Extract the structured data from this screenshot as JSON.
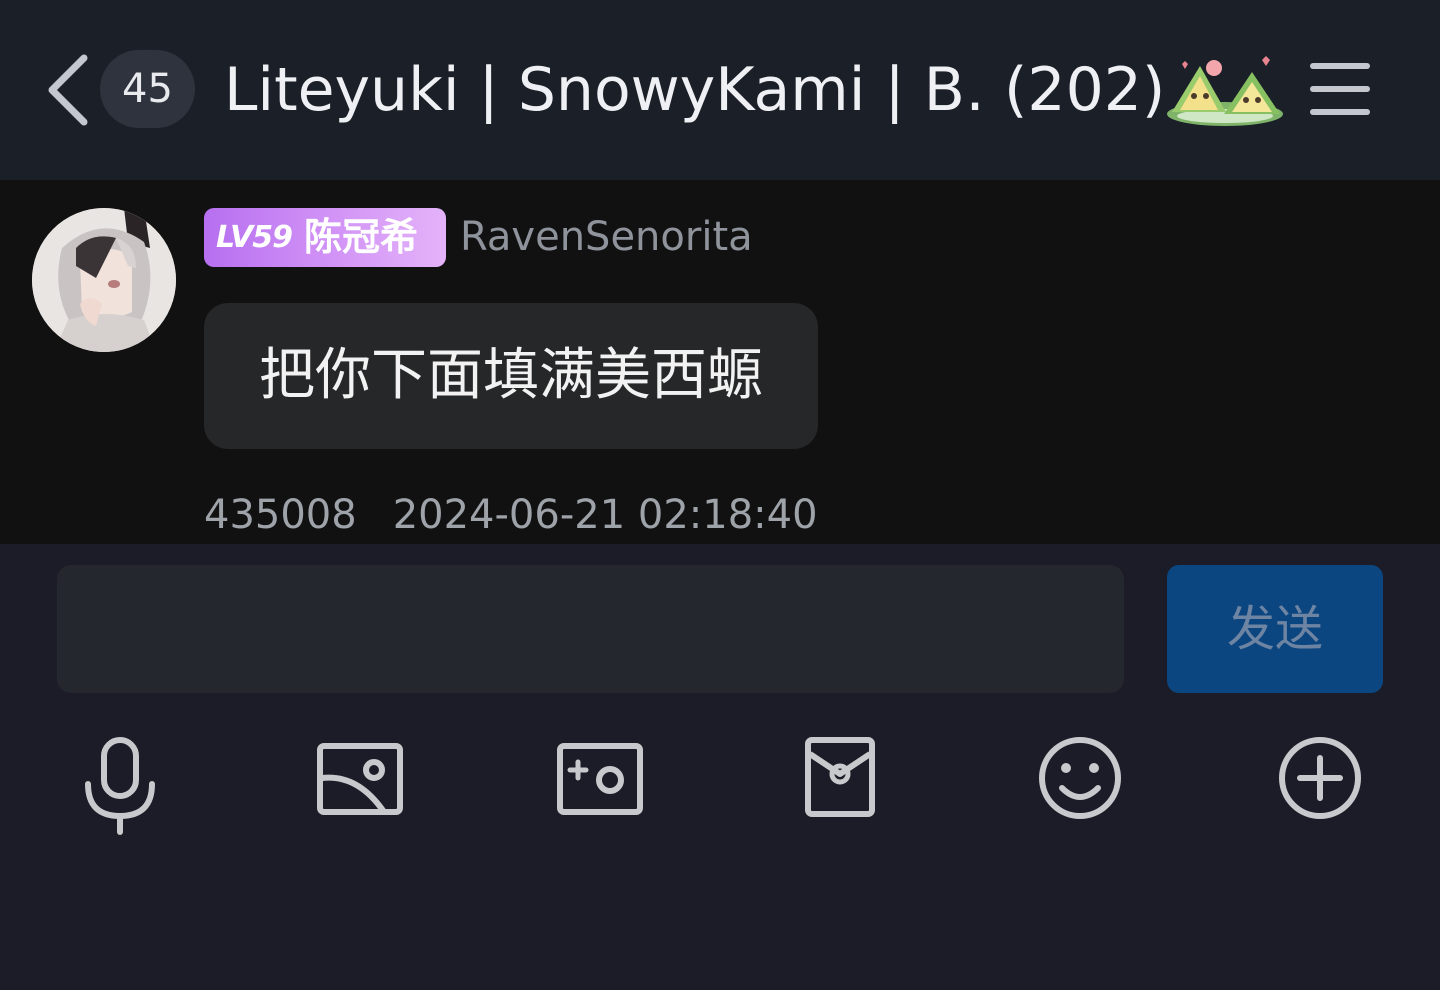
{
  "header": {
    "unread_count": "45",
    "title": "Liteyuki | SnowyKami | B…",
    "member_count": "(202)"
  },
  "message": {
    "level_label": "LV59",
    "member_title": "陈冠希",
    "sender": "RavenSenorita",
    "text": "把你下面填满美西螈",
    "id": "435008",
    "time": "2024-06-21 02:18:40"
  },
  "composer": {
    "input_value": "",
    "send_label": "发送"
  },
  "toolbar": {
    "icons": [
      "microphone-icon",
      "image-icon",
      "camera-icon",
      "red-packet-icon",
      "emoji-icon",
      "plus-icon"
    ]
  },
  "colors": {
    "header_bg": "#1b1f28",
    "chat_bg": "#111111",
    "panel_bg": "#1b1c27",
    "bubble_bg": "#262728",
    "send_button_bg": "#0b4681",
    "badge_gradient_start": "#b66ff0",
    "badge_gradient_end": "#e4b3f9"
  }
}
